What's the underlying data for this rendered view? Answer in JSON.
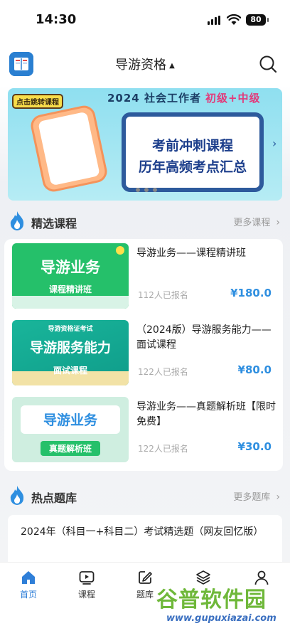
{
  "status": {
    "time": "14:30",
    "battery": "80"
  },
  "header": {
    "title": "导游资格",
    "caret": "▲"
  },
  "banner": {
    "tag": "点击跳转课程",
    "top_text": "2024 社会工作者",
    "level_text": "初级+中级",
    "line1": "考前冲刺课程",
    "line2": "历年高频考点汇总"
  },
  "featured": {
    "title": "精选课程",
    "more": "更多课程",
    "courses": [
      {
        "thumb_line1": "导游业务",
        "thumb_line2": "课程精讲班",
        "thumb_top": "",
        "title": "导游业务——课程精讲班",
        "count": "112人已报名",
        "price": "¥180.0"
      },
      {
        "thumb_top": "导游资格证考试",
        "thumb_line1": "导游服务能力",
        "thumb_line2": "面试课程",
        "title": "（2024版）导游服务能力——面试课程",
        "count": "122人已报名",
        "price": "¥80.0"
      },
      {
        "thumb_top": "",
        "thumb_line1": "导游业务",
        "thumb_line2": "真题解析班",
        "title": "导游业务——真题解析班【限时免费】",
        "count": "122人已报名",
        "price": "¥30.0"
      }
    ]
  },
  "hot": {
    "title": "热点题库",
    "more": "更多题库",
    "items": [
      {
        "title": "2024年（科目一+科目二）考试精选题（网友回忆版）"
      }
    ]
  },
  "tabs": [
    {
      "label": "首页",
      "icon": "home-icon",
      "active": true
    },
    {
      "label": "课程",
      "icon": "video-icon",
      "active": false
    },
    {
      "label": "题库",
      "icon": "edit-icon",
      "active": false
    },
    {
      "label": "",
      "icon": "layers-icon",
      "active": false
    },
    {
      "label": "",
      "icon": "user-icon",
      "active": false
    }
  ],
  "watermark": {
    "big": "谷普软件园",
    "small": "www.gupuxiazai.com"
  },
  "colors": {
    "accent": "#2f8fe0",
    "brand_blue": "#2f7fd8"
  }
}
